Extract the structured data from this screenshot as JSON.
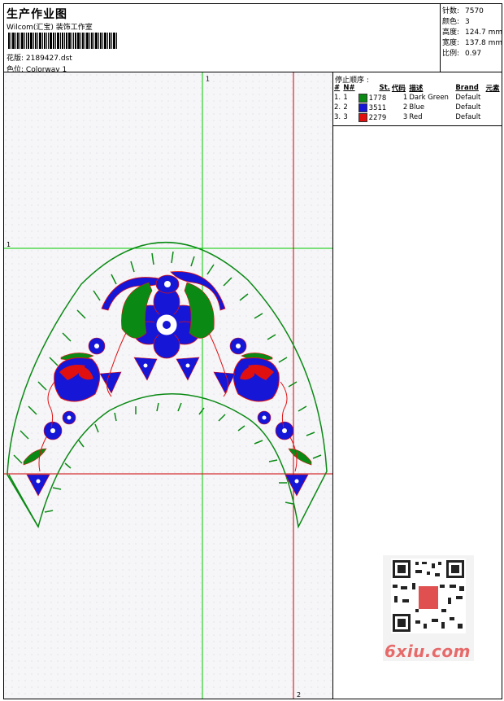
{
  "header": {
    "title": "生产作业图",
    "company": "Wilcom(汇宝) 装饰工作室",
    "design_file_label": "花版:",
    "design_file": "2189427.dst",
    "colorway_label": "色位:",
    "colorway": "Colorway 1"
  },
  "stats": {
    "stitches_label": "针数:",
    "stitches": "7570",
    "colors_label": "颜色:",
    "colors": "3",
    "height_label": "高度:",
    "height": "124.7 mm",
    "width_label": "宽度:",
    "width": "137.8 mm",
    "scale_label": "比例:",
    "scale": "0.97"
  },
  "stop_sequence": {
    "title": "停止顺序 :",
    "columns": [
      "#",
      "N#",
      "St.",
      "代码",
      "描述",
      "Brand",
      "元素"
    ],
    "rows": [
      {
        "idx": "1.",
        "n": "1",
        "color": "#0a8a14",
        "st": "1778",
        "code": "1",
        "desc": "Dark Green",
        "brand": "Default"
      },
      {
        "idx": "2.",
        "n": "2",
        "color": "#1616d6",
        "st": "3511",
        "code": "2",
        "desc": "Blue",
        "brand": "Default"
      },
      {
        "idx": "3.",
        "n": "3",
        "color": "#e01010",
        "st": "2279",
        "code": "3",
        "desc": "Red",
        "brand": "Default"
      }
    ]
  },
  "canvas": {
    "markers": {
      "green_v": "1",
      "green_h": "1",
      "red_v": "2"
    },
    "colors": {
      "green": "#0a8a14",
      "blue": "#1616d6",
      "red": "#e01010",
      "guide_green": "#00cc00",
      "guide_red": "#cc0000"
    }
  },
  "watermark": {
    "text": "6xiu.com"
  }
}
